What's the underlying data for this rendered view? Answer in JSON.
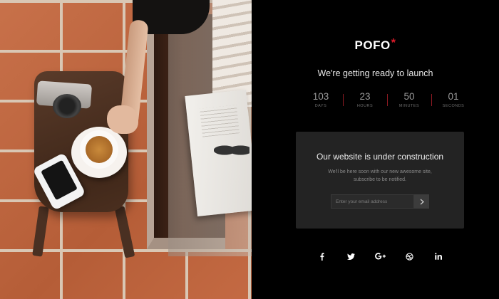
{
  "brand": {
    "name": "POFO",
    "mark": "*"
  },
  "headline": "We're getting ready to launch",
  "countdown": [
    {
      "value": "103",
      "label": "DAYS"
    },
    {
      "value": "23",
      "label": "HOURS"
    },
    {
      "value": "50",
      "label": "MINUTES"
    },
    {
      "value": "01",
      "label": "SECONDS"
    }
  ],
  "notice": {
    "title": "Our website is under construction",
    "text": "We'll be here soon with our new awesome site, subscribe to be notified.",
    "email_placeholder": "Enter your email address"
  },
  "social": [
    {
      "icon": "facebook-icon"
    },
    {
      "icon": "twitter-icon"
    },
    {
      "icon": "google-plus-icon"
    },
    {
      "icon": "dribbble-icon"
    },
    {
      "icon": "linkedin-icon"
    }
  ],
  "colors": {
    "accent": "#e01b2a",
    "background": "#000000",
    "card": "#232323"
  }
}
